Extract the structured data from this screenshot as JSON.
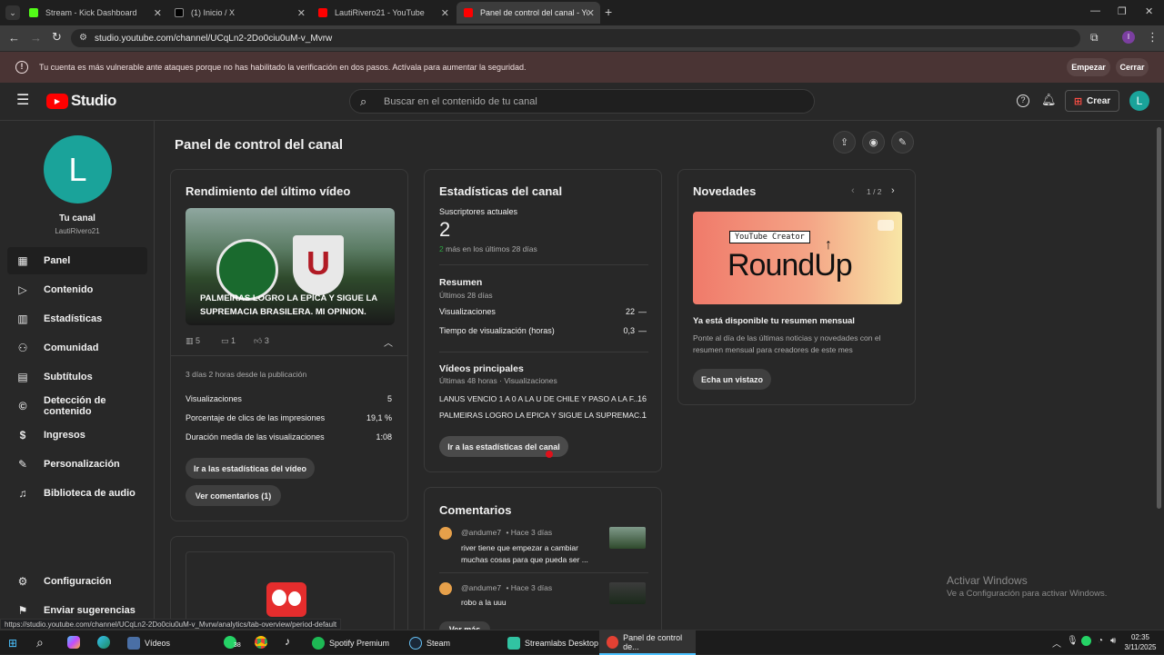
{
  "browser": {
    "tabs": [
      {
        "label": "Stream - Kick Dashboard",
        "color": "#53fc18"
      },
      {
        "label": "(1) Inicio / X",
        "color": "#ffffff"
      },
      {
        "label": "LautiRivero21 - YouTube",
        "color": "#ff0000"
      },
      {
        "label": "Panel de control del canal - You",
        "color": "#ff0000"
      }
    ],
    "url": "studio.youtube.com/channel/UCqLn2-2Do0ciu0uM-v_Mvrw"
  },
  "banner": {
    "text": "Tu cuenta es más vulnerable ante ataques porque no has habilitado la verificación en dos pasos. Actívala para aumentar la seguridad.",
    "start_label": "Empezar",
    "close_label": "Cerrar"
  },
  "header": {
    "logo": "Studio",
    "search_placeholder": "Buscar en el contenido de tu canal",
    "create_label": "Crear",
    "avatar_letter": "L",
    "accent": "#1aa39a"
  },
  "sidebar": {
    "avatar_letter": "L",
    "channel_title": "Tu canal",
    "channel_name": "LautiRivero21",
    "items": [
      {
        "label": "Panel",
        "icon": "dashboard-icon"
      },
      {
        "label": "Contenido",
        "icon": "content-icon"
      },
      {
        "label": "Estadísticas",
        "icon": "analytics-icon"
      },
      {
        "label": "Comunidad",
        "icon": "community-icon"
      },
      {
        "label": "Subtítulos",
        "icon": "subtitles-icon"
      },
      {
        "label": "Detección de contenido",
        "icon": "copyright-icon"
      },
      {
        "label": "Ingresos",
        "icon": "dollar-icon"
      },
      {
        "label": "Personalización",
        "icon": "wand-icon"
      },
      {
        "label": "Biblioteca de audio",
        "icon": "audio-library-icon"
      }
    ],
    "settings_label": "Configuración",
    "feedback_label": "Enviar sugerencias"
  },
  "main": {
    "page_title": "Panel de control del canal",
    "latest_video": {
      "title": "Rendimiento del último vídeo",
      "thumb_caption": "PALMEIRAS LOGRO LA EPICA Y SIGUE LA SUPREMACIA BRASILERA. MI OPINION.",
      "stat_views": "5",
      "stat_comments": "1",
      "stat_likes": "3",
      "published": "3 días 2 horas desde la publicación",
      "rows": [
        {
          "label": "Visualizaciones",
          "value": "5"
        },
        {
          "label": "Porcentaje de clics de las impresiones",
          "value": "19,1 %"
        },
        {
          "label": "Duración media de las visualizaciones",
          "value": "1:08"
        }
      ],
      "analytics_btn": "Ir a las estadísticas del vídeo",
      "comments_btn": "Ver comentarios (1)"
    },
    "channel_stats": {
      "title": "Estadísticas del canal",
      "subs_label": "Suscriptores actuales",
      "subs_value": "2",
      "subs_delta_num": "2",
      "subs_delta_text": "más en los últimos 28 días",
      "summary_title": "Resumen",
      "summary_period": "Últimos 28 días",
      "summary_rows": [
        {
          "label": "Visualizaciones",
          "value": "22",
          "trend": "—"
        },
        {
          "label": "Tiempo de visualización (horas)",
          "value": "0,3",
          "trend": "—"
        }
      ],
      "top_title": "Vídeos principales",
      "top_period": "Últimas 48 horas · Visualizaciones",
      "top_rows": [
        {
          "label": "LANUS VENCIO 1 A 0 A LA U DE CHILE Y PASO A LA F...",
          "value": "16"
        },
        {
          "label": "PALMEIRAS LOGRO LA EPICA Y SIGUE LA SUPREMAC...",
          "value": "1"
        }
      ],
      "analytics_btn": "Ir a las estadísticas del canal"
    },
    "comments": {
      "title": "Comentarios",
      "items": [
        {
          "author": "@andume7",
          "time": "• Hace 3 días",
          "text": "river tiene que empezar a cambiar muchas cosas para que pueda ser ..."
        },
        {
          "author": "@andume7",
          "time": "• Hace 3 días",
          "text": "robo a la uuu"
        }
      ],
      "more_btn": "Ver más"
    },
    "news": {
      "title": "Novedades",
      "pager": "1 / 2",
      "card_tag": "YouTube Creator",
      "card_big": "RoundUp",
      "headline": "Ya está disponible tu resumen mensual",
      "body": "Ponte al día de las últimas noticias y novedades con el resumen mensual para creadores de este mes",
      "cta": "Echa un vistazo"
    }
  },
  "watermark": {
    "line1": "Activar Windows",
    "line2": "Ve a Configuración para activar Windows."
  },
  "status_url": "https://studio.youtube.com/channel/UCqLn2-2Do0ciu0uM-v_Mvrw/analytics/tab-overview/period-default",
  "taskbar": {
    "items": [
      {
        "label": "Vídeos",
        "color": "#4a6fa5"
      },
      {
        "label": "Spotify Premium",
        "color": "#1db954"
      },
      {
        "label": "Steam",
        "color": "#1b2838"
      },
      {
        "label": "Streamlabs Desktop",
        "color": "#31c3a2"
      },
      {
        "label": "Panel de control de...",
        "color": "#e34133"
      }
    ],
    "whatsapp_badge": "38",
    "time": "02:35",
    "date": "3/11/2025"
  }
}
